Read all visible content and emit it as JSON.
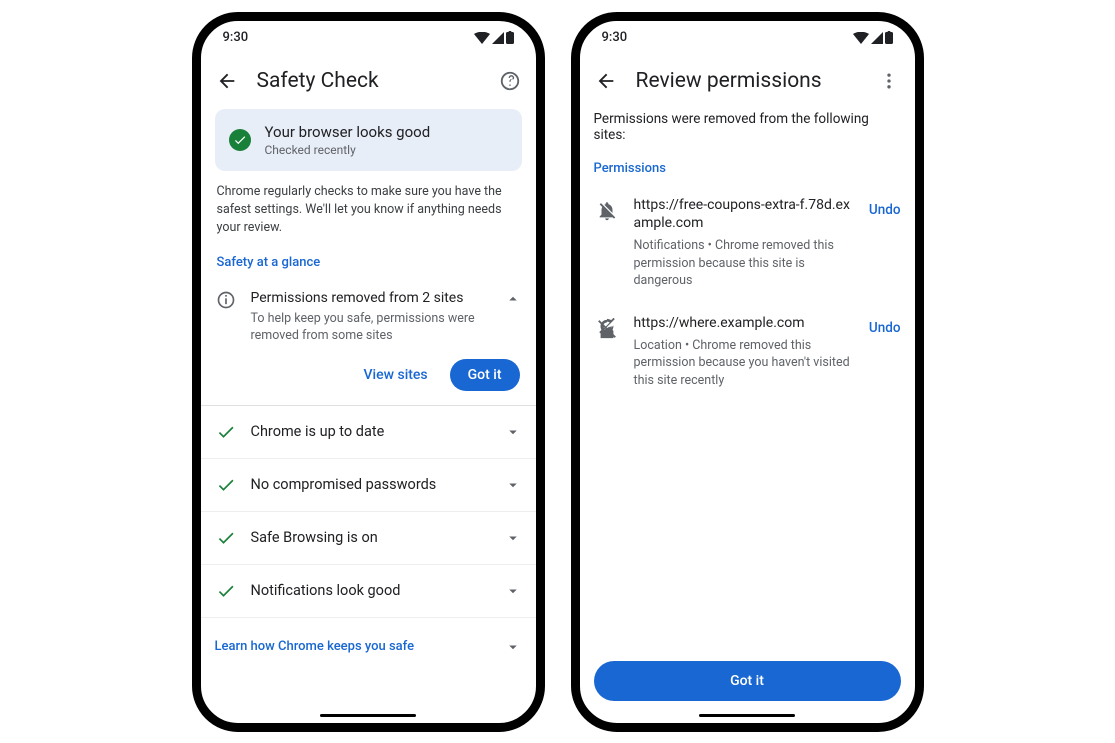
{
  "status_time": "9:30",
  "left": {
    "title": "Safety Check",
    "status_card": {
      "heading": "Your browser looks good",
      "sub": "Checked recently"
    },
    "body_text": "Chrome regularly checks to make sure you have the safest settings. We'll let you know if anything needs your review.",
    "glance_label": "Safety at a glance",
    "permissions": {
      "title": "Permissions removed from 2 sites",
      "sub": "To help keep you safe, permissions were removed from some sites",
      "view_label": "View sites",
      "gotit_label": "Got it"
    },
    "checks": [
      {
        "label": "Chrome is up to date"
      },
      {
        "label": "No compromised passwords"
      },
      {
        "label": "Safe Browsing is on"
      },
      {
        "label": "Notifications look good"
      }
    ],
    "learn_link": "Learn how Chrome keeps you safe"
  },
  "right": {
    "title": "Review permissions",
    "intro": "Permissions were removed from the following sites:",
    "section_label": "Permissions",
    "undo_label": "Undo",
    "gotit_label": "Got it",
    "sites": [
      {
        "icon": "bell-off",
        "url": "https://free-coupons-extra-f.78d.example.com",
        "desc": "Notifications • Chrome removed this permission because this site is dangerous"
      },
      {
        "icon": "location-off",
        "url": "https://where.example.com",
        "desc": "Location • Chrome removed this permission because you haven't visited this site recently"
      }
    ]
  }
}
